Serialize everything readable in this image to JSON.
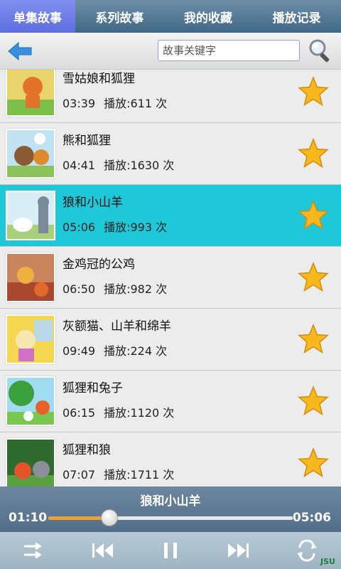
{
  "tabs": [
    {
      "label": "单集故事",
      "active": true
    },
    {
      "label": "系列故事",
      "active": false
    },
    {
      "label": "我的收藏",
      "active": false
    },
    {
      "label": "播放记录",
      "active": false
    }
  ],
  "search": {
    "placeholder": "故事关键字"
  },
  "stories": [
    {
      "title": "雪姑娘和狐狸",
      "duration": "03:39",
      "plays": "播放:611 次",
      "selected": false
    },
    {
      "title": "熊和狐狸",
      "duration": "04:41",
      "plays": "播放:1630 次",
      "selected": false
    },
    {
      "title": "狼和小山羊",
      "duration": "05:06",
      "plays": "播放:993 次",
      "selected": true
    },
    {
      "title": "金鸡冠的公鸡",
      "duration": "06:50",
      "plays": "播放:982 次",
      "selected": false
    },
    {
      "title": "灰额猫、山羊和绵羊",
      "duration": "09:49",
      "plays": "播放:224 次",
      "selected": false
    },
    {
      "title": "狐狸和兔子",
      "duration": "06:15",
      "plays": "播放:1120 次",
      "selected": false
    },
    {
      "title": "狐狸和狼",
      "duration": "07:07",
      "plays": "播放:1711 次",
      "selected": false
    }
  ],
  "player": {
    "now_playing": "狼和小山羊",
    "current_time": "01:10",
    "total_time": "05:06",
    "progress": 0.25
  },
  "watermark": "JSU",
  "colors": {
    "selected_row": "#1ec8d8",
    "active_tab": "#6a7ae8",
    "progress_fill": "#f0a030",
    "star": "#f6b81c"
  }
}
